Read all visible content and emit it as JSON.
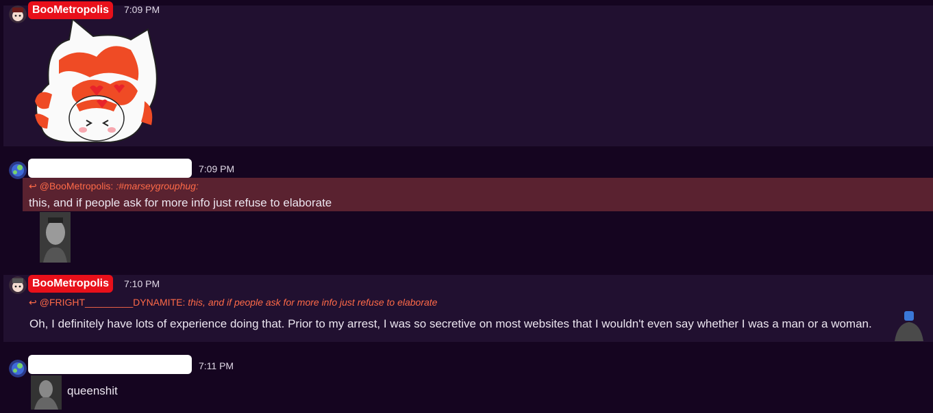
{
  "messages": [
    {
      "username": "BooMetropolis",
      "time": "7:09 PM",
      "sticker": "marseygrouphug"
    },
    {
      "username": "",
      "time": "7:09 PM",
      "reply": {
        "mention": "@BooMetropolis:",
        "text": ":#marseygrouphug:"
      },
      "text": "this, and if people ask for more info just refuse to elaborate"
    },
    {
      "username": "BooMetropolis",
      "time": "7:10 PM",
      "reply": {
        "mention": "@FRIGHT_________DYNAMITE:",
        "text": "this, and if people ask for more info just refuse to elaborate"
      },
      "text": "Oh, I definitely have lots of experience doing that. Prior to my arrest, I was so secretive on most websites that I wouldn't even say whether I was a man or a woman."
    },
    {
      "username": "",
      "time": "7:11 PM",
      "text": "queenshit"
    }
  ],
  "reply_icon": "reply-arrow-icon",
  "colors": {
    "background": "#150520",
    "highlight": "#211030",
    "username_badge": "#e8101a",
    "reply": "#ff6a48",
    "quote_bg": "#5a2230"
  }
}
